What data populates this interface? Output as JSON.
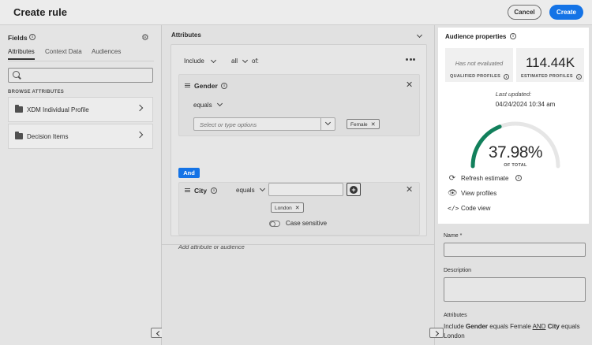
{
  "header": {
    "title": "Create rule",
    "cancel_label": "Cancel",
    "create_label": "Create"
  },
  "fields": {
    "title": "Fields",
    "tabs": [
      {
        "label": "Attributes",
        "active": true
      },
      {
        "label": "Context Data",
        "active": false
      },
      {
        "label": "Audiences",
        "active": false
      }
    ],
    "search_placeholder": "",
    "browse_label": "BROWSE ATTRIBUTES",
    "items": [
      {
        "label": "XDM Individual Profile",
        "icon": "folder-icon"
      },
      {
        "label": "Decision Items",
        "icon": "folder-icon"
      }
    ]
  },
  "attributes": {
    "title": "Attributes",
    "include_label": "Include",
    "all_label": "all",
    "of_label": "of:",
    "conditions": [
      {
        "name": "Gender",
        "operator": "equals",
        "select_placeholder": "Select or type options",
        "tags": [
          "Female"
        ]
      },
      {
        "name": "City",
        "operator": "equals",
        "value": "",
        "tags": [
          "London"
        ],
        "toggle_label": "Case sensitive"
      }
    ],
    "and_label": "And",
    "add_placeholder": "Add attribute or audience"
  },
  "audience": {
    "title": "Audience properties",
    "qualified_text": "Has not evaluated",
    "qualified_label": "QUALIFIED PROFILES",
    "estimated_value": "114.44K",
    "estimated_label": "ESTIMATED PROFILES",
    "last_updated_label": "Last updated:",
    "last_updated_value": "04/24/2024 10:34 am",
    "percent_text": "37.98%",
    "percent_value": 37.98,
    "of_total_label": "OF TOTAL",
    "gauge_color": "#12805c",
    "gauge_track_color": "#e6e6e6",
    "actions": [
      {
        "label": "Refresh estimate",
        "icon": "refresh-icon"
      },
      {
        "label": "View profiles",
        "icon": "eye-icon"
      },
      {
        "label": "Code view",
        "icon": "code-icon"
      }
    ]
  },
  "form": {
    "name_label": "Name",
    "required_mark": "*",
    "name_value": "",
    "description_label": "Description",
    "description_value": "",
    "summary_heading": "Attributes",
    "summary": {
      "include": "Include",
      "field1": "Gender",
      "op1": "equals",
      "val1": "Female",
      "and": "AND",
      "field2": "City",
      "op2": "equals",
      "val2": "London"
    }
  },
  "colors": {
    "accent": "#1473e6"
  }
}
